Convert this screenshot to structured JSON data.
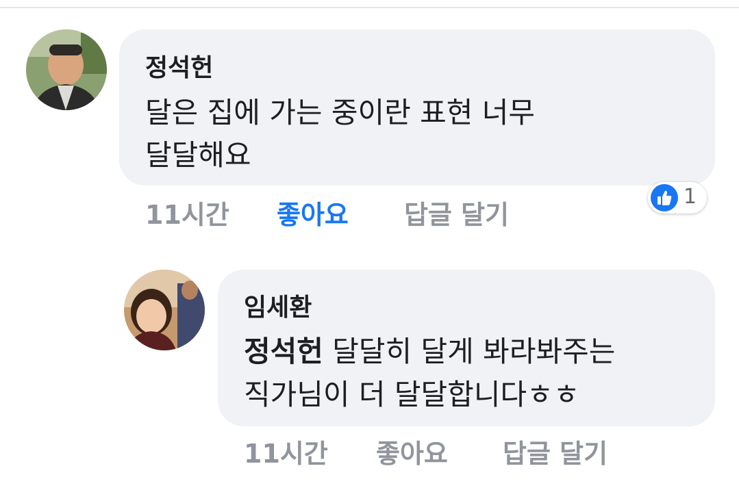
{
  "comments": [
    {
      "author": "정석헌",
      "text_lines": [
        "달은 집에 가는 중이란 표현 너무",
        "달달해요"
      ],
      "time": "11시간",
      "like_label": "좋아요",
      "reply_label": "답글 달기",
      "liked": true,
      "reaction": {
        "icon": "thumbs-up-icon",
        "count": "1"
      }
    },
    {
      "author": "임세환",
      "mention": "정석헌",
      "text_line1_rest": " 달달히 달게 봐라봐주는",
      "text_line2": "직가님이 더 달달합니다ㅎㅎ",
      "time": "11시간",
      "like_label": "좋아요",
      "reply_label": "답글 달기",
      "liked": false
    }
  ],
  "colors": {
    "bubble_bg": "#f0f2f5",
    "meta_text": "#90949c",
    "liked_blue": "#1877f2",
    "text": "#1c1e21"
  }
}
